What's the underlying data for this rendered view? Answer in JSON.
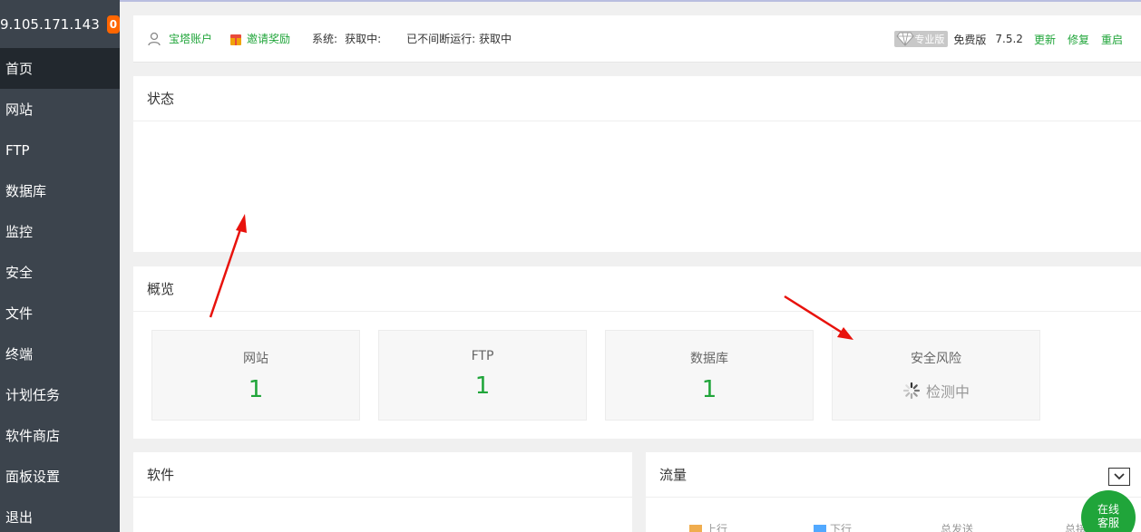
{
  "sidebar": {
    "ip": "9.105.171.143",
    "badge": "0",
    "items": [
      {
        "label": "首页"
      },
      {
        "label": "网站"
      },
      {
        "label": "FTP"
      },
      {
        "label": "数据库"
      },
      {
        "label": "监控"
      },
      {
        "label": "安全"
      },
      {
        "label": "文件"
      },
      {
        "label": "终端"
      },
      {
        "label": "计划任务"
      },
      {
        "label": "软件商店"
      },
      {
        "label": "面板设置"
      },
      {
        "label": "退出"
      }
    ]
  },
  "header": {
    "account": "宝塔账户",
    "invite": "邀请奖励",
    "system_label": "系统:",
    "system_value": "获取中:",
    "uptime": "已不间断运行: 获取中",
    "pro": "专业版",
    "free": "免费版",
    "version": "7.5.2",
    "update": "更新",
    "repair": "修复",
    "restart": "重启"
  },
  "status_panel": {
    "title": "状态"
  },
  "overview": {
    "title": "概览",
    "cards": [
      {
        "title": "网站",
        "value": "1"
      },
      {
        "title": "FTP",
        "value": "1"
      },
      {
        "title": "数据库",
        "value": "1"
      },
      {
        "title": "安全风险",
        "value": "检测中"
      }
    ]
  },
  "software": {
    "title": "软件"
  },
  "traffic": {
    "title": "流量",
    "up": "上行",
    "down": "下行",
    "total_send": "总发送",
    "total_recv": "总接"
  },
  "chat": {
    "line1": "在线",
    "line2": "客服"
  },
  "colors": {
    "accent": "#20a53a",
    "sidebar": "#3c444d",
    "badge": "#ff6600",
    "arrow": "#e8120c"
  }
}
